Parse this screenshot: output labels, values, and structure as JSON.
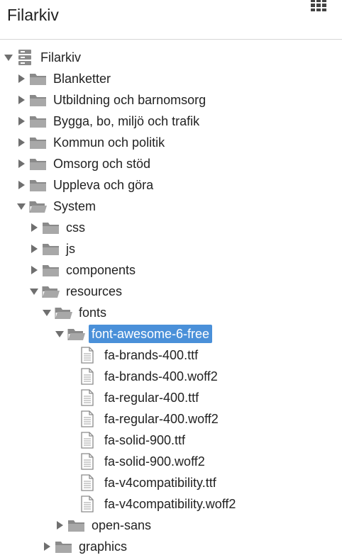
{
  "header": {
    "title": "Filarkiv",
    "menu_icon": "grid-icon"
  },
  "tree": [
    {
      "id": "root",
      "label": "Filarkiv",
      "depth": 0,
      "icon": "server-icon",
      "state": "expanded"
    },
    {
      "id": "blanketter",
      "label": "Blanketter",
      "depth": 1,
      "icon": "folder-icon",
      "state": "collapsed"
    },
    {
      "id": "utbildning",
      "label": "Utbildning och barnomsorg",
      "depth": 1,
      "icon": "folder-icon",
      "state": "collapsed"
    },
    {
      "id": "bygga",
      "label": "Bygga, bo, miljö och trafik",
      "depth": 1,
      "icon": "folder-icon",
      "state": "collapsed"
    },
    {
      "id": "kommun",
      "label": "Kommun och politik",
      "depth": 1,
      "icon": "folder-icon",
      "state": "collapsed"
    },
    {
      "id": "omsorg",
      "label": "Omsorg och stöd",
      "depth": 1,
      "icon": "folder-icon",
      "state": "collapsed"
    },
    {
      "id": "uppleva",
      "label": "Uppleva och göra",
      "depth": 1,
      "icon": "folder-icon",
      "state": "collapsed"
    },
    {
      "id": "system",
      "label": "System",
      "depth": 1,
      "icon": "folder-open-icon",
      "state": "expanded"
    },
    {
      "id": "css",
      "label": "css",
      "depth": 2,
      "icon": "folder-icon",
      "state": "collapsed"
    },
    {
      "id": "js",
      "label": "js",
      "depth": 2,
      "icon": "folder-icon",
      "state": "collapsed"
    },
    {
      "id": "components",
      "label": "components",
      "depth": 2,
      "icon": "folder-icon",
      "state": "collapsed"
    },
    {
      "id": "resources",
      "label": "resources",
      "depth": 2,
      "icon": "folder-open-icon",
      "state": "expanded"
    },
    {
      "id": "fonts",
      "label": "fonts",
      "depth": 3,
      "icon": "folder-open-icon",
      "state": "expanded"
    },
    {
      "id": "fa6",
      "label": "font-awesome-6-free",
      "depth": 4,
      "icon": "folder-open-icon",
      "state": "expanded",
      "selected": true
    },
    {
      "id": "f1",
      "label": "fa-brands-400.ttf",
      "depth": 5,
      "icon": "file-icon",
      "state": "leaf"
    },
    {
      "id": "f2",
      "label": "fa-brands-400.woff2",
      "depth": 5,
      "icon": "file-icon",
      "state": "leaf"
    },
    {
      "id": "f3",
      "label": "fa-regular-400.ttf",
      "depth": 5,
      "icon": "file-icon",
      "state": "leaf"
    },
    {
      "id": "f4",
      "label": "fa-regular-400.woff2",
      "depth": 5,
      "icon": "file-icon",
      "state": "leaf"
    },
    {
      "id": "f5",
      "label": "fa-solid-900.ttf",
      "depth": 5,
      "icon": "file-icon",
      "state": "leaf"
    },
    {
      "id": "f6",
      "label": "fa-solid-900.woff2",
      "depth": 5,
      "icon": "file-icon",
      "state": "leaf"
    },
    {
      "id": "f7",
      "label": "fa-v4compatibility.ttf",
      "depth": 5,
      "icon": "file-icon",
      "state": "leaf"
    },
    {
      "id": "f8",
      "label": "fa-v4compatibility.woff2",
      "depth": 5,
      "icon": "file-icon",
      "state": "leaf"
    },
    {
      "id": "opensans",
      "label": "open-sans",
      "depth": 4,
      "icon": "folder-icon",
      "state": "collapsed"
    },
    {
      "id": "graphics",
      "label": "graphics",
      "depth": 3,
      "icon": "folder-icon",
      "state": "collapsed"
    }
  ],
  "colors": {
    "selection": "#4a90d9",
    "icon_gray": "#8a8a8a",
    "twisty": "#6f6f6f"
  }
}
